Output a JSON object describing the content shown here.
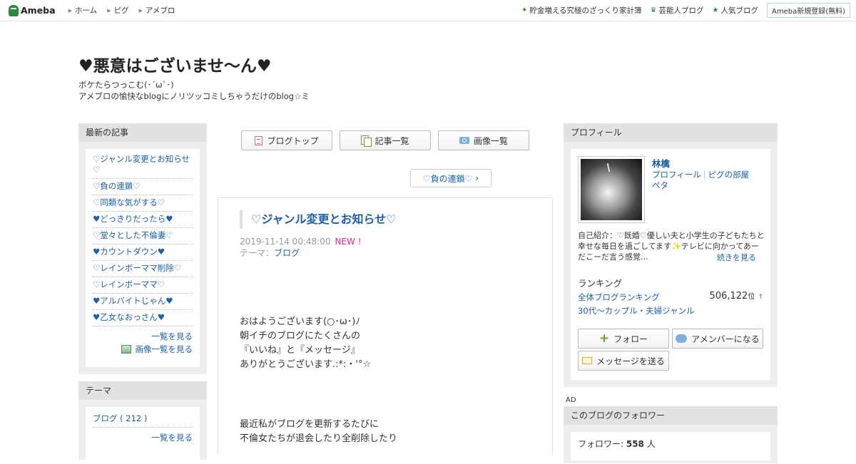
{
  "topbar": {
    "logo": "Ameba",
    "nav": [
      "ホーム",
      "ピグ",
      "アメブロ"
    ],
    "right": [
      {
        "icon": "sparkle-icon",
        "label": "貯金増える究極のざっくり家計簿"
      },
      {
        "icon": "crown-icon",
        "label": "芸能人ブログ"
      },
      {
        "icon": "star-icon",
        "label": "人気ブログ"
      }
    ],
    "register": "Ameba新規登録(無料)"
  },
  "header": {
    "title": "♥悪意はございませ～ん♥",
    "desc_line1": "ボケたらつっこむ(･´ω`･)",
    "desc_line2": "アメブロの愉快なblogにノリツッコミしちゃうだけのblog☆ミ"
  },
  "recent": {
    "heading": "最新の記事",
    "items": [
      "♡ジャンル変更とお知らせ♡",
      "♡負の連鎖♡",
      "♡同類な気がする♡",
      "♥どっきりだったら♥",
      "♡堂々とした不倫妻♡",
      "♥カウントダウン♥",
      "♡レインボーママ削除♡",
      "♡レインボーママ♡",
      "♥アルバイトじゃん♥",
      "♥乙女なおっさん♥"
    ],
    "more": "一覧を見る",
    "more_images": "画像一覧を見る"
  },
  "theme": {
    "heading": "テーマ",
    "item": "ブログ ( 212 )",
    "more": "一覧を見る"
  },
  "center": {
    "btn_top": "ブログトップ",
    "btn_list": "記事一覧",
    "btn_images": "画像一覧",
    "prev": "♡負の連鎖♡"
  },
  "article": {
    "title": "♡ジャンル変更とお知らせ♡",
    "date": "2019-11-14 00:48:00",
    "new": "NEW !",
    "theme_label": "テーマ：",
    "theme": "ブログ",
    "body1": [
      "おはようございます(○･ω･)ﾉ",
      "朝イチのブログにたくさんの",
      "『いいね』と『メッセージ』",
      "ありがとうございます.:*:・'°☆"
    ],
    "body2": [
      "最近私がブログを更新するたびに",
      "不倫女たちが退会したり全削除したり"
    ]
  },
  "profile": {
    "heading": "プロフィール",
    "name": "林檎",
    "link_profile": "プロフィール",
    "link_pig": "ピグの部屋",
    "link_peta": "ペタ",
    "intro": "自己紹介：♡既婚♡優しい夫と小学生の子どもたちと幸せな毎日を過ごしてます✨テレビに向かってあーだこーだ言う感覚...",
    "intro_more": "続きを見る",
    "ranking_head": "ランキング",
    "rank1_label": "全体ブログランキング",
    "rank1_value": "506,122",
    "rank1_unit": "位",
    "rank2_label": "30代〜カップル・夫婦ジャンル",
    "btn_follow": "フォロー",
    "btn_member": "アメンバーになる",
    "btn_message": "メッセージを送る"
  },
  "ad": "AD",
  "followers": {
    "heading": "このブログのフォロワー",
    "label": "フォロワー: ",
    "count": "558",
    "unit": " 人"
  }
}
